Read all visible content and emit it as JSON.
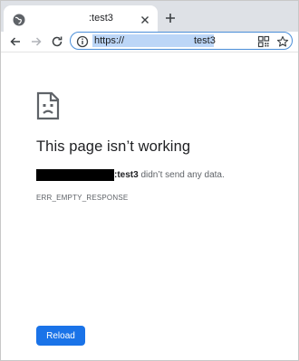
{
  "tab": {
    "title": ":test3",
    "favicon_icon": "globe-icon",
    "close_icon": "close-icon"
  },
  "toolbar": {
    "new_tab_icon": "plus-icon",
    "back_icon": "arrow-left-icon",
    "forward_icon": "arrow-right-icon",
    "reload_icon": "reload-icon",
    "site_info_icon": "info-icon",
    "qr_icon": "qr-code-icon",
    "bookmark_icon": "star-icon"
  },
  "omnibox": {
    "scheme": "https://",
    "host_suffix": "test3"
  },
  "error": {
    "icon": "sad-page-icon",
    "title": "This page isn’t working",
    "host": ":test3",
    "message": " didn’t send any data.",
    "code": "ERR_EMPTY_RESPONSE",
    "reload_label": "Reload"
  },
  "colors": {
    "accent": "#1a73e8",
    "tabstrip": "#dee1e6",
    "selection": "#bcd6f7"
  }
}
